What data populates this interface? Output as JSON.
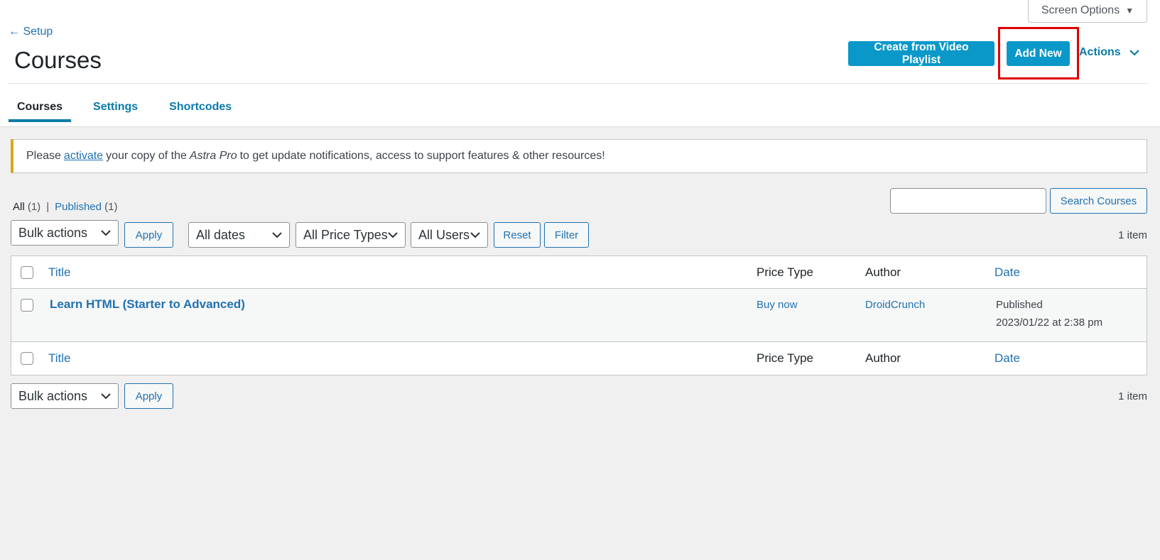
{
  "screen_options": {
    "label": "Screen Options",
    "caret": "▼"
  },
  "header": {
    "back_link": "← Setup",
    "title": "Courses",
    "create_playlist_label": "Create from Video Playlist",
    "add_new_label": "Add New",
    "actions_label": "Actions"
  },
  "tabs": [
    {
      "label": "Courses",
      "active": true
    },
    {
      "label": "Settings",
      "active": false
    },
    {
      "label": "Shortcodes",
      "active": false
    }
  ],
  "notice": {
    "prefix": "Please",
    "link": "activate",
    "middle": "your copy of the",
    "product": "Astra Pro",
    "suffix": "to get update notifications, access to support features & other resources!"
  },
  "filters": {
    "all_label": "All",
    "all_count": "(1)",
    "separator": "|",
    "published_label": "Published",
    "published_count": "(1)"
  },
  "search": {
    "button_label": "Search Courses",
    "value": ""
  },
  "top_nav": {
    "bulk_actions": "Bulk actions",
    "apply": "Apply",
    "dates": "All dates",
    "price_types": "All Price Types",
    "users": "All Users",
    "reset": "Reset",
    "filter": "Filter",
    "count": "1 item"
  },
  "table": {
    "columns": {
      "title": "Title",
      "price_type": "Price Type",
      "author": "Author",
      "date": "Date"
    },
    "rows": [
      {
        "title": "Learn HTML (Starter to Advanced)",
        "price_type": "Buy now",
        "author": "DroidCrunch",
        "status": "Published",
        "date": "2023/01/22 at 2:38 pm"
      }
    ]
  },
  "bottom_nav": {
    "bulk_actions": "Bulk actions",
    "apply": "Apply",
    "count": "1 item"
  },
  "colors": {
    "primary_button": "#0a98c9",
    "link": "#2271b1",
    "highlight": "#e00000",
    "notice_border": "#dba617"
  }
}
